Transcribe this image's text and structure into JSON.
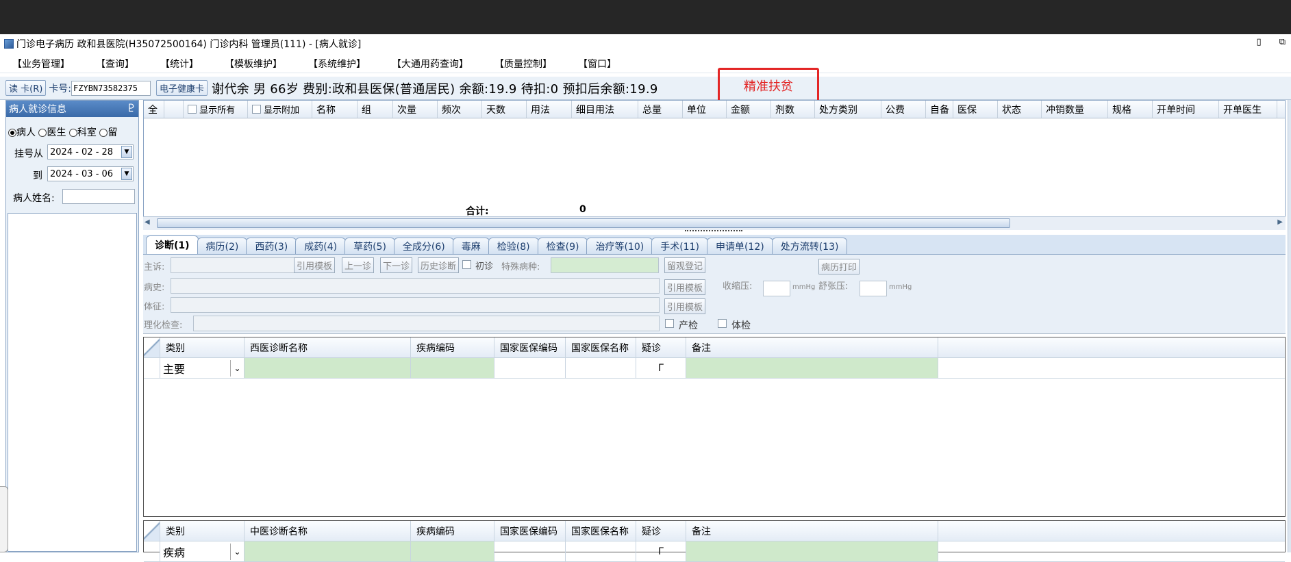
{
  "window": {
    "title": "门诊电子病历  政和县医院(H35072500164)  门诊内科  管理员(111) - [病人就诊]",
    "min_glyph": "▯",
    "restore_glyph": "⧉"
  },
  "menu": [
    "【业务管理】",
    "【查询】",
    "【统计】",
    "【模板维护】",
    "【系统维护】",
    "【大通用药查询】",
    "【质量控制】",
    "【窗口】"
  ],
  "infobar": {
    "read_card": "读 卡(R)",
    "card_label": "卡号:",
    "card_no": "FZYBN73582375",
    "ecard": "电子健康卡",
    "patient": "谢代余 男 66岁 费别:政和县医保(普通居民) 余额:19.9 待扣:0 预扣后余额:19.9",
    "poverty": "精准扶贫"
  },
  "left_panel": {
    "title": "病人就诊信息",
    "pin": "Ⴒ",
    "radios": [
      "病人",
      "医生",
      "科室",
      "留"
    ],
    "reg_from_label": "挂号从",
    "reg_from": "2024 - 02 - 28",
    "reg_to_label": "到",
    "reg_to": "2024 - 03 - 06",
    "name_label": "病人姓名:",
    "name_value": ""
  },
  "rx_grid": {
    "all_label": "全",
    "show_all": "显示所有",
    "show_extra": "显示附加",
    "columns": [
      "名称",
      "组",
      "次量",
      "频次",
      "天数",
      "用法",
      "细目用法",
      "总量",
      "单位",
      "金额",
      "剂数",
      "处方类别",
      "公费",
      "自备",
      "医保",
      "状态",
      "冲销数量",
      "规格",
      "开单时间",
      "开单医生"
    ],
    "total_label": "合计:",
    "total_value": "0"
  },
  "tabs": [
    "诊断(1)",
    "病历(2)",
    "西药(3)",
    "成药(4)",
    "草药(5)",
    "全成分(6)",
    "毒麻",
    "检验(8)",
    "检查(9)",
    "治疗等(10)",
    "手术(11)",
    "申请单(12)",
    "处方流转(13)"
  ],
  "diag_form": {
    "chief": "主诉:",
    "history": "病史:",
    "signs": "体征:",
    "lab": "理化检查:",
    "btn_tpl": "引用模板",
    "btn_prev": "上一诊",
    "btn_next": "下一诊",
    "btn_hist": "历史诊断",
    "first_visit": "初诊",
    "special_disease": "特殊病种:",
    "btn_obs": "留观登记",
    "btn_print": "病历打印",
    "systolic": "收缩压:",
    "diastolic": "舒张压:",
    "unit": "mmHg",
    "prenatal": "产检",
    "physical": "体检"
  },
  "western_diag": {
    "columns": [
      "类别",
      "西医诊断名称",
      "疾病编码",
      "国家医保编码",
      "国家医保名称",
      "疑诊",
      "备注"
    ],
    "row_type": "主要",
    "row_check": "Γ"
  },
  "chinese_diag": {
    "columns": [
      "类别",
      "中医诊断名称",
      "疾病编码",
      "国家医保编码",
      "国家医保名称",
      "疑诊",
      "备注"
    ],
    "row_type": "疾病",
    "row_check": "Γ"
  }
}
